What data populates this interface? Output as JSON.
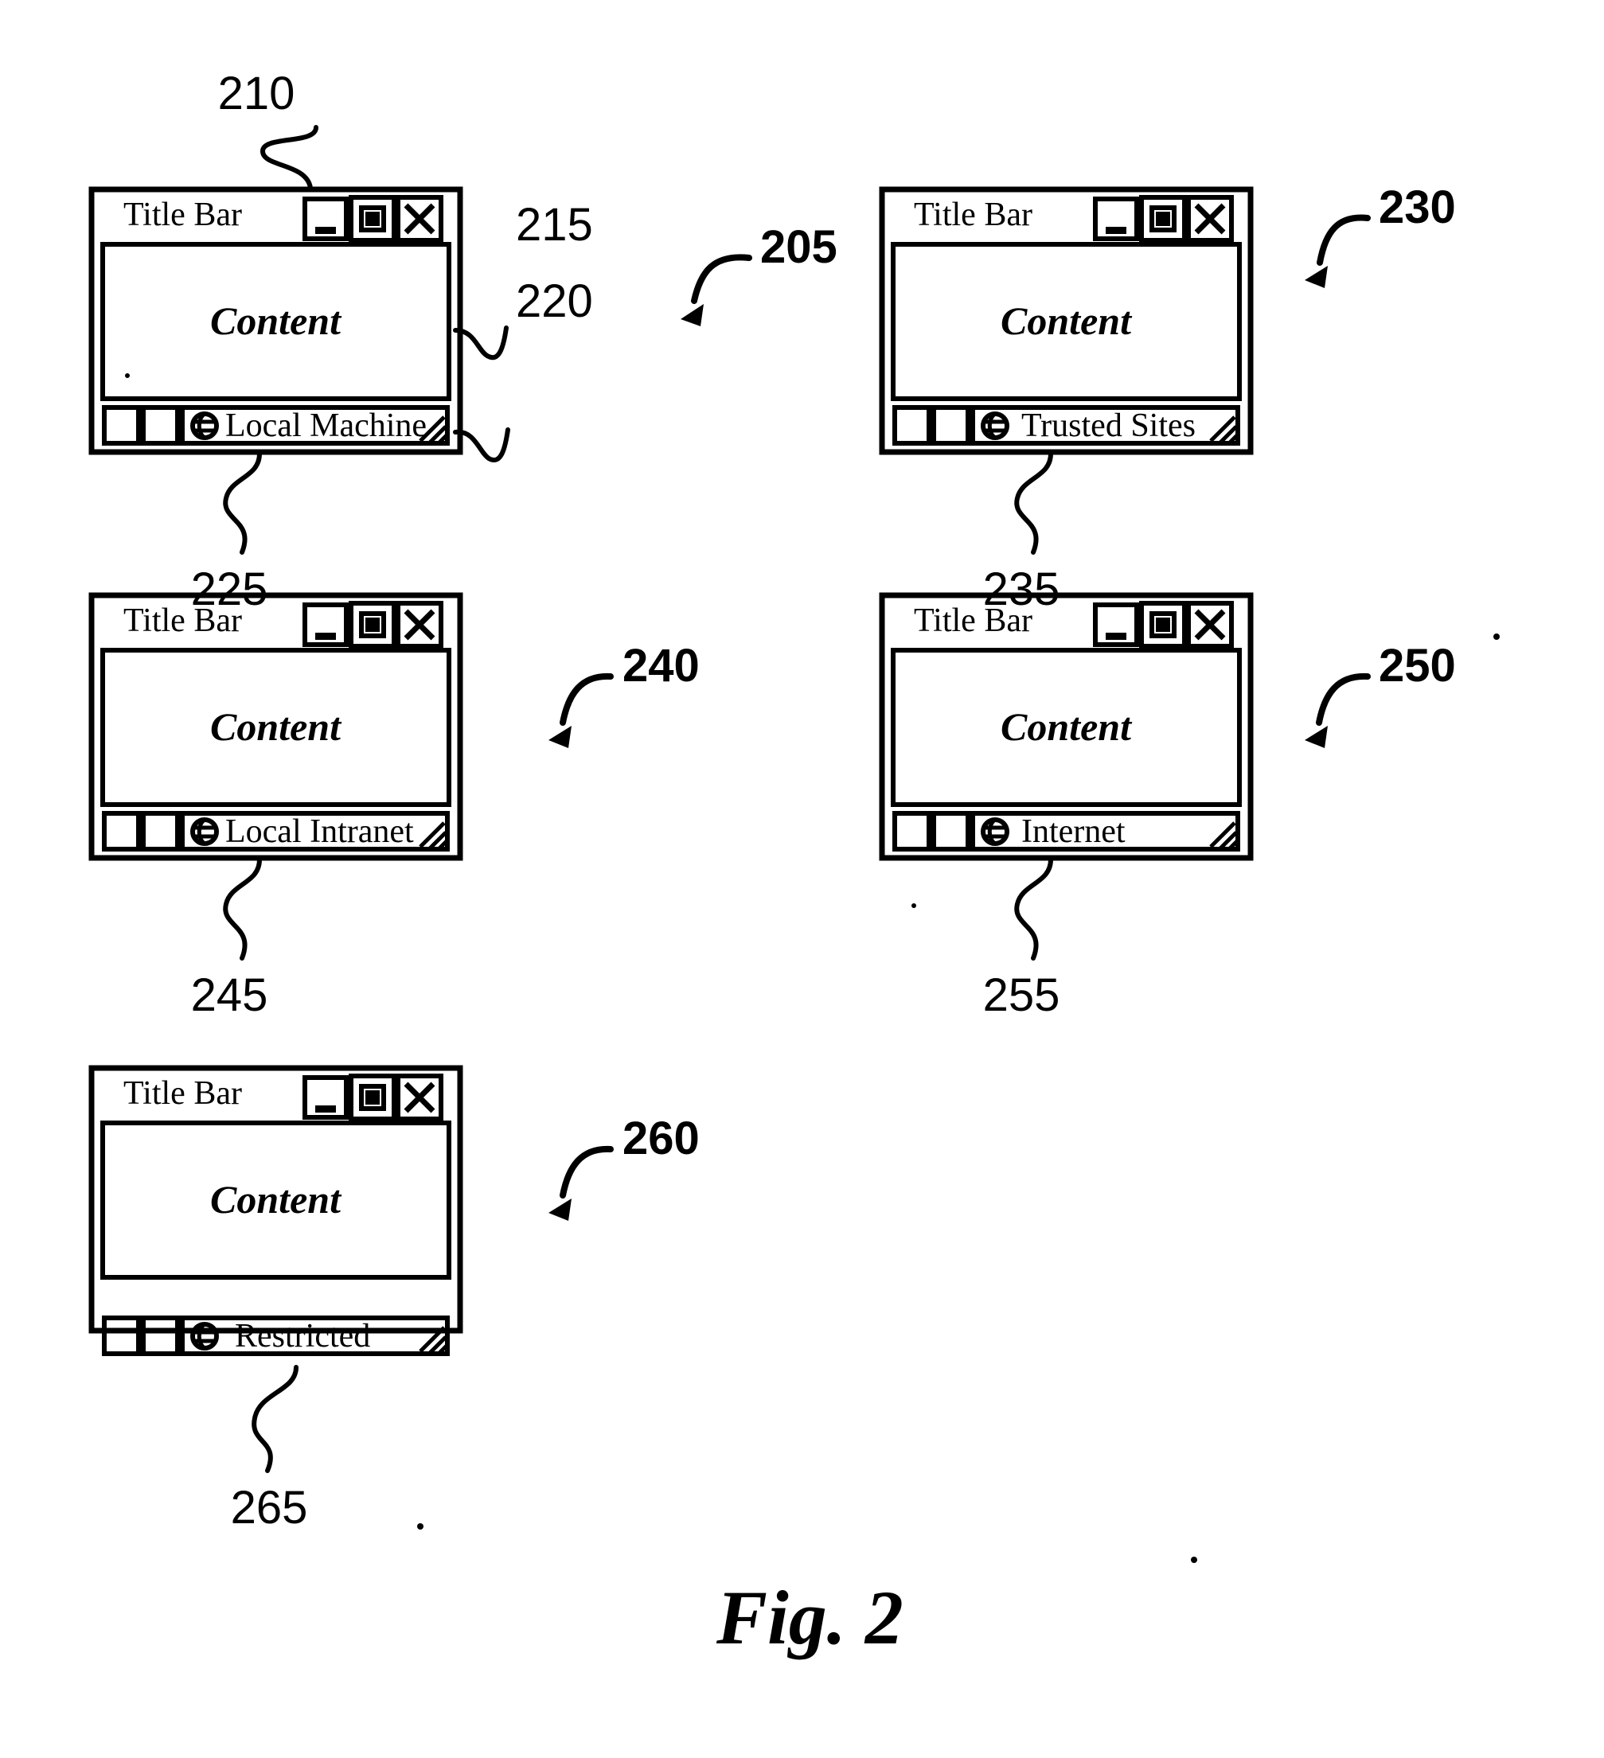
{
  "figure": {
    "caption": "Fig. 2",
    "overall_ref": "205"
  },
  "common": {
    "title_bar_label": "Title Bar",
    "content_label": "Content",
    "globe_icon": "globe-icon",
    "minimize_icon": "minimize-icon",
    "maximize_icon": "maximize-restore-icon",
    "close_icon": "close-icon",
    "resize_grip_icon": "resize-grip-icon"
  },
  "windows": [
    {
      "id": "local-machine",
      "title": "Title Bar",
      "content": "Content",
      "zone": "Local Machine",
      "window_ref": "210",
      "content_ref": "215",
      "statusbar_ref": "220",
      "zone_ref": "225"
    },
    {
      "id": "trusted-sites",
      "title": "Title Bar",
      "content": "Content",
      "zone": "Trusted Sites",
      "window_ref": "230",
      "content_ref": "",
      "statusbar_ref": "",
      "zone_ref": "235"
    },
    {
      "id": "local-intranet",
      "title": "Title Bar",
      "content": "Content",
      "zone": "Local Intranet",
      "window_ref": "240",
      "content_ref": "",
      "statusbar_ref": "",
      "zone_ref": "245"
    },
    {
      "id": "internet",
      "title": "Title Bar",
      "content": "Content",
      "zone": "Internet",
      "window_ref": "250",
      "content_ref": "",
      "statusbar_ref": "",
      "zone_ref": "255"
    },
    {
      "id": "restricted",
      "title": "Title Bar",
      "content": "Content",
      "zone": "Restricted",
      "window_ref": "260",
      "content_ref": "",
      "statusbar_ref": "",
      "zone_ref": "265"
    }
  ],
  "refs": {
    "r205": "205",
    "r210": "210",
    "r215": "215",
    "r220": "220",
    "r225": "225",
    "r230": "230",
    "r235": "235",
    "r240": "240",
    "r245": "245",
    "r250": "250",
    "r255": "255",
    "r260": "260",
    "r265": "265"
  },
  "colors": {
    "ink": "#000000",
    "paper": "#ffffff"
  }
}
